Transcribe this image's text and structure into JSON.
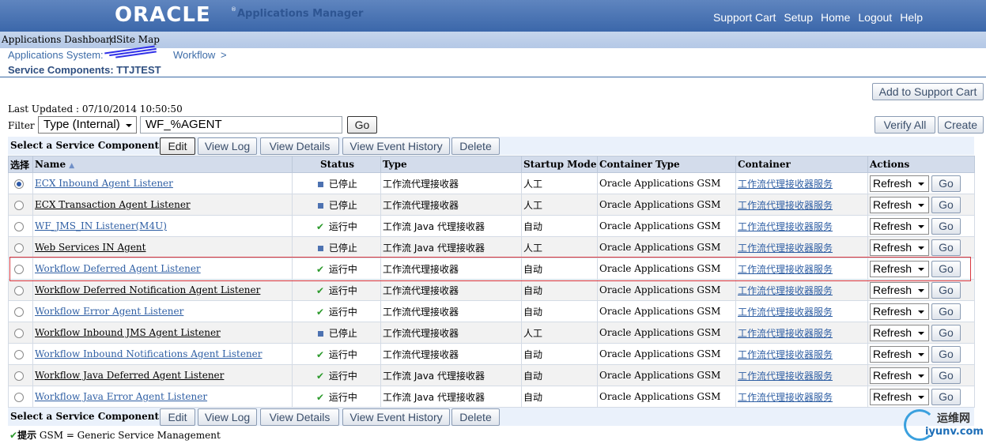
{
  "header": {
    "logo": "ORACLE",
    "logo_mark": "®",
    "app_name": "Applications Manager",
    "links": [
      "Support Cart",
      "Setup",
      "Home",
      "Logout",
      "Help"
    ]
  },
  "tabs": [
    "Applications Dashboard",
    "Site Map"
  ],
  "breadcrumb": {
    "root": "Applications System:",
    "current": "Workflow",
    "separator": ">"
  },
  "page_title": "Service Components: TTJTEST",
  "toolbar": {
    "add_to_cart": "Add to Support Cart",
    "verify_all": "Verify All",
    "create": "Create"
  },
  "last_updated": "Last Updated : 07/10/2014 10:50:50",
  "filter": {
    "label": "Filter",
    "type_value": "Type (Internal)",
    "text_value": "WF_%AGENT",
    "go_label": "Go"
  },
  "control_bar": {
    "label": "Select a Service Component and ...",
    "buttons": [
      "Edit",
      "View Log",
      "View Details",
      "View Event History",
      "Delete"
    ]
  },
  "table": {
    "headers": [
      "选择",
      "Name",
      "Status",
      "Type",
      "Startup Mode",
      "Container Type",
      "Container",
      "Actions"
    ],
    "sort_indicator": "▲",
    "rows": [
      {
        "name": "ECX Inbound Agent Listener",
        "status": "已停止",
        "type": "工作流代理接收器",
        "mode": "人工",
        "ctype": "Oracle Applications GSM",
        "container": "工作流代理接收器服务",
        "action": "Refresh",
        "go": "Go"
      },
      {
        "name": "ECX Transaction Agent Listener",
        "status": "已停止",
        "type": "工作流代理接收器",
        "mode": "人工",
        "ctype": "Oracle Applications GSM",
        "container": "工作流代理接收器服务",
        "action": "Refresh",
        "go": "Go"
      },
      {
        "name": "WF_JMS_IN Listener(M4U)",
        "status": "运行中",
        "type": "工作流  Java 代理接收器",
        "mode": "自动",
        "ctype": "Oracle Applications GSM",
        "container": "工作流代理接收器服务",
        "action": "Refresh",
        "go": "Go"
      },
      {
        "name": "Web Services IN Agent",
        "status": "已停止",
        "type": "工作流  Java 代理接收器",
        "mode": "人工",
        "ctype": "Oracle Applications GSM",
        "container": "工作流代理接收器服务",
        "action": "Refresh",
        "go": "Go"
      },
      {
        "name": "Workflow Deferred Agent Listener",
        "status": "运行中",
        "type": "工作流代理接收器",
        "mode": "自动",
        "ctype": "Oracle Applications GSM",
        "container": "工作流代理接收器服务",
        "action": "Refresh",
        "go": "Go"
      },
      {
        "name": "Workflow Deferred Notification Agent Listener",
        "status": "运行中",
        "type": "工作流代理接收器",
        "mode": "自动",
        "ctype": "Oracle Applications GSM",
        "container": "工作流代理接收器服务",
        "action": "Refresh",
        "go": "Go"
      },
      {
        "name": "Workflow Error Agent Listener",
        "status": "运行中",
        "type": "工作流代理接收器",
        "mode": "自动",
        "ctype": "Oracle Applications GSM",
        "container": "工作流代理接收器服务",
        "action": "Refresh",
        "go": "Go"
      },
      {
        "name": "Workflow Inbound JMS Agent Listener",
        "status": "已停止",
        "type": "工作流代理接收器",
        "mode": "人工",
        "ctype": "Oracle Applications GSM",
        "container": "工作流代理接收器服务",
        "action": "Refresh",
        "go": "Go"
      },
      {
        "name": "Workflow Inbound Notifications Agent Listener",
        "status": "运行中",
        "type": "工作流代理接收器",
        "mode": "自动",
        "ctype": "Oracle Applications GSM",
        "container": "工作流代理接收器服务",
        "action": "Refresh",
        "go": "Go"
      },
      {
        "name": "Workflow Java Deferred Agent Listener",
        "status": "运行中",
        "type": "工作流  Java 代理接收器",
        "mode": "自动",
        "ctype": "Oracle Applications GSM",
        "container": "工作流代理接收器服务",
        "action": "Refresh",
        "go": "Go"
      },
      {
        "name": "Workflow Java Error Agent Listener",
        "status": "运行中",
        "type": "工作流  Java 代理接收器",
        "mode": "自动",
        "ctype": "Oracle Applications GSM",
        "container": "工作流代理接收器服务",
        "action": "Refresh",
        "go": "Go"
      }
    ]
  },
  "tip": {
    "label": "提示",
    "text": "GSM = Generic Service Management"
  },
  "watermark": {
    "name": "运维网",
    "url": "iyunv.com"
  },
  "colors": {
    "header_blue": "#3b67aa",
    "link_blue": "#2f5fa4",
    "running_green": "#2c9a2c",
    "highlight_red": "#d9363e"
  }
}
